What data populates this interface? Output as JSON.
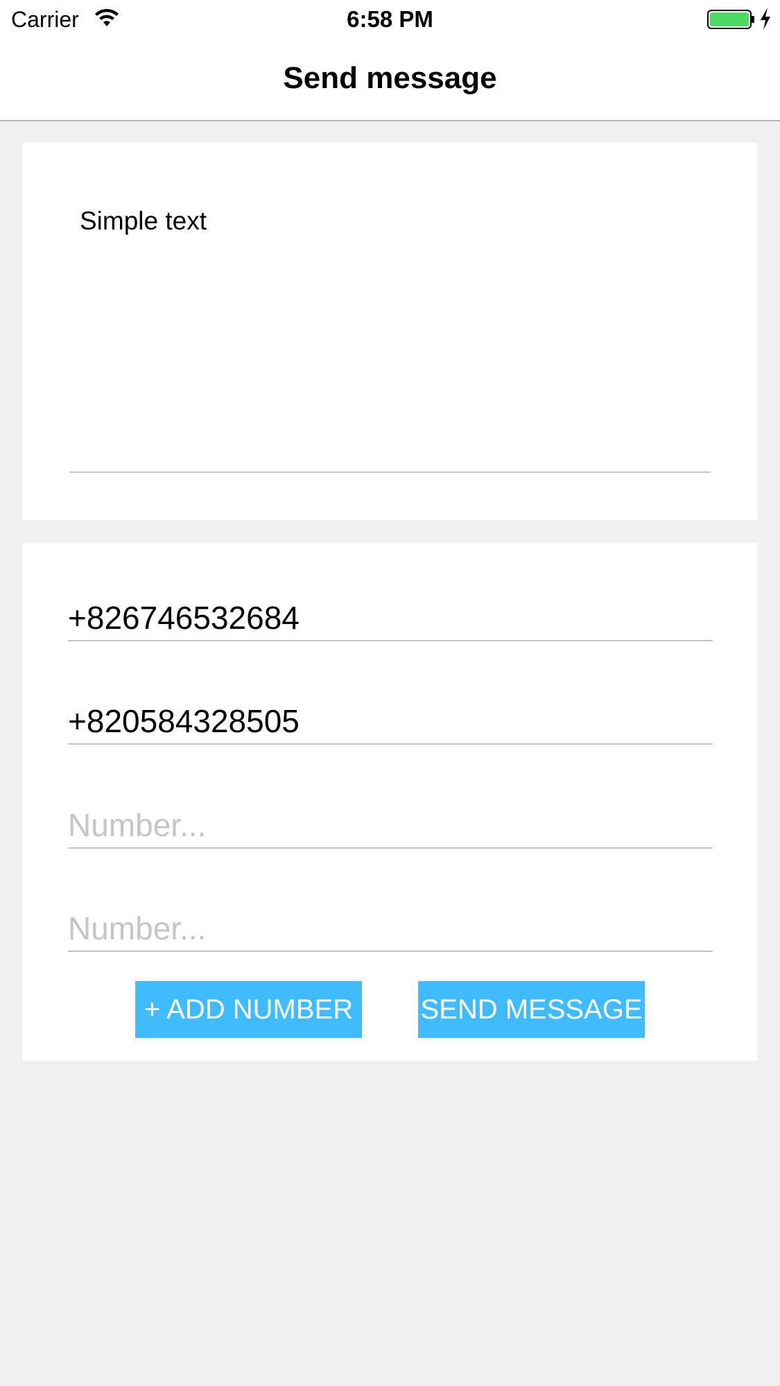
{
  "status_bar": {
    "carrier": "Carrier",
    "time": "6:58 PM",
    "wifi_icon": "wifi-icon",
    "battery_icon": "battery-charging-icon",
    "battery_color": "#4cd964"
  },
  "nav": {
    "title": "Send message"
  },
  "message": {
    "text": "Simple text"
  },
  "numbers": {
    "fields": [
      {
        "value": "+826746532684",
        "placeholder": "Number..."
      },
      {
        "value": "+820584328505",
        "placeholder": "Number..."
      },
      {
        "value": "",
        "placeholder": "Number..."
      },
      {
        "value": "",
        "placeholder": "Number..."
      }
    ]
  },
  "buttons": {
    "add_number": "+ ADD NUMBER",
    "send_message": "SEND MESSAGE",
    "color": "#3fbcff"
  }
}
